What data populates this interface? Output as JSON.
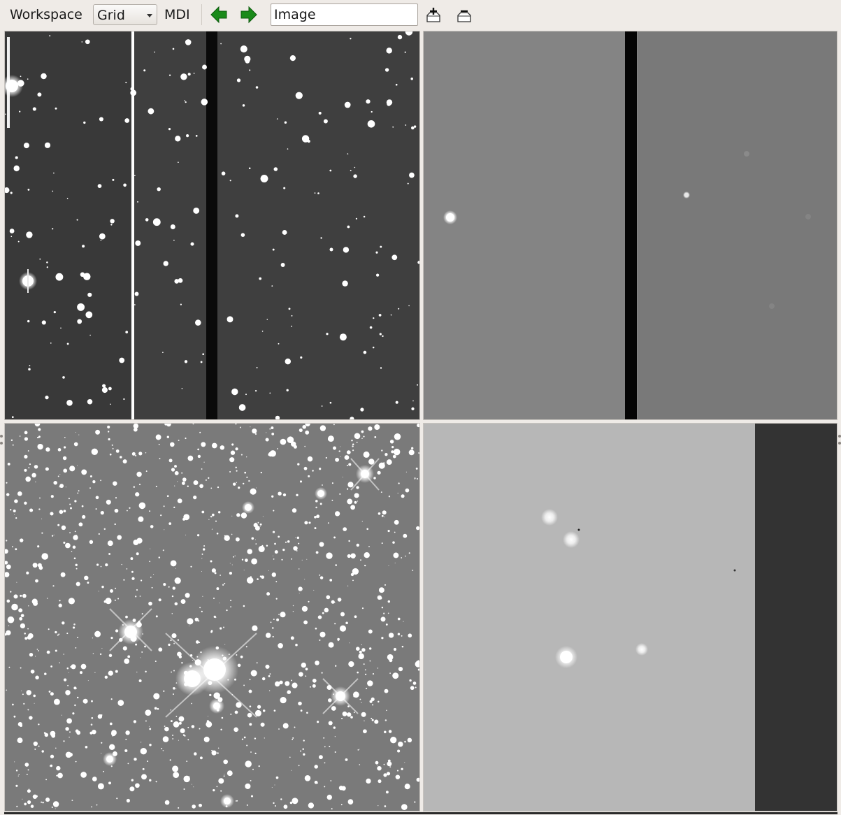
{
  "toolbar": {
    "workspace_label": "Workspace",
    "layout_select": {
      "value": "Grid",
      "options": [
        "Grid"
      ]
    },
    "mdi_label": "MDI",
    "prev_icon": "green-left-arrow-icon",
    "next_icon": "green-right-arrow-icon",
    "frame_input": {
      "value": "Image",
      "placeholder": ""
    },
    "add_icon": "add-frame-icon",
    "delete_icon": "delete-frame-icon"
  },
  "frames": [
    {
      "name": "frame-1",
      "content": "star-field-dark"
    },
    {
      "name": "frame-2",
      "content": "gray-field-sparse"
    },
    {
      "name": "frame-3",
      "content": "dense-star-field"
    },
    {
      "name": "frame-4",
      "content": "light-gray-field"
    }
  ],
  "colors": {
    "toolbar_bg": "#efebe7",
    "arrow_green": "#1a8a1a"
  }
}
